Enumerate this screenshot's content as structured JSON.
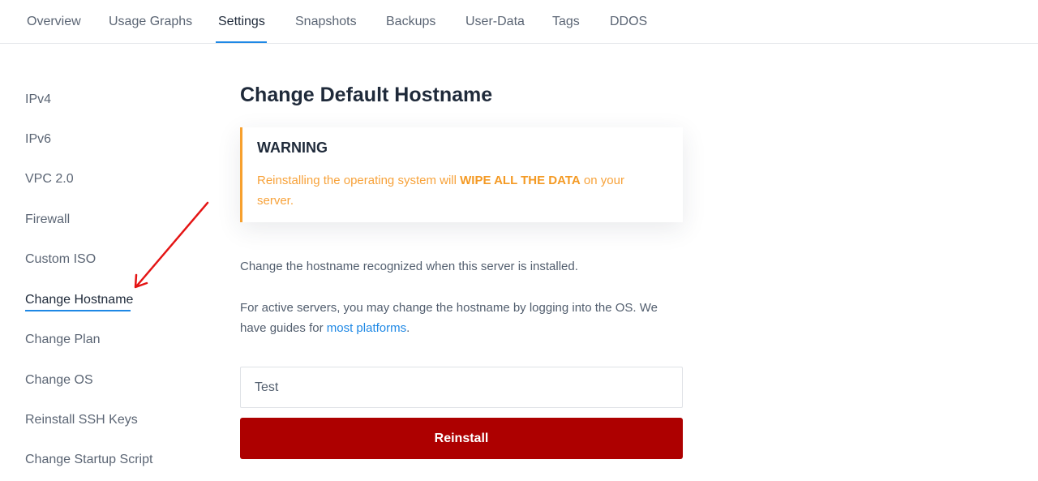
{
  "tabs": [
    {
      "label": "Overview",
      "active": false
    },
    {
      "label": "Usage Graphs",
      "active": false
    },
    {
      "label": "Settings",
      "active": true
    },
    {
      "label": "Snapshots",
      "active": false
    },
    {
      "label": "Backups",
      "active": false
    },
    {
      "label": "User-Data",
      "active": false
    },
    {
      "label": "Tags",
      "active": false
    },
    {
      "label": "DDOS",
      "active": false
    }
  ],
  "sidebar": {
    "items": [
      {
        "label": "IPv4",
        "active": false
      },
      {
        "label": "IPv6",
        "active": false
      },
      {
        "label": "VPC 2.0",
        "active": false
      },
      {
        "label": "Firewall",
        "active": false
      },
      {
        "label": "Custom ISO",
        "active": false
      },
      {
        "label": "Change Hostname",
        "active": true
      },
      {
        "label": "Change Plan",
        "active": false
      },
      {
        "label": "Change OS",
        "active": false
      },
      {
        "label": "Reinstall SSH Keys",
        "active": false
      },
      {
        "label": "Change Startup Script",
        "active": false
      }
    ]
  },
  "main": {
    "title": "Change Default Hostname",
    "warning": {
      "title": "WARNING",
      "text_before": "Reinstalling the operating system will ",
      "text_bold": "WIPE ALL THE DATA",
      "text_after": " on your server."
    },
    "description": "Change the hostname recognized when this server is installed.",
    "guides_text_before": "For active servers, you may change the hostname by logging into the OS. We have guides for ",
    "guides_link": "most platforms",
    "guides_text_after": ".",
    "hostname_input": {
      "value": "Test"
    },
    "reinstall_button": "Reinstall"
  },
  "colors": {
    "accent": "#1e88e5",
    "warning": "#f7a02e",
    "danger": "#ad0000",
    "annotation_arrow": "#e41414"
  },
  "annotation": {
    "type": "arrow",
    "points_to": "Change Hostname"
  }
}
